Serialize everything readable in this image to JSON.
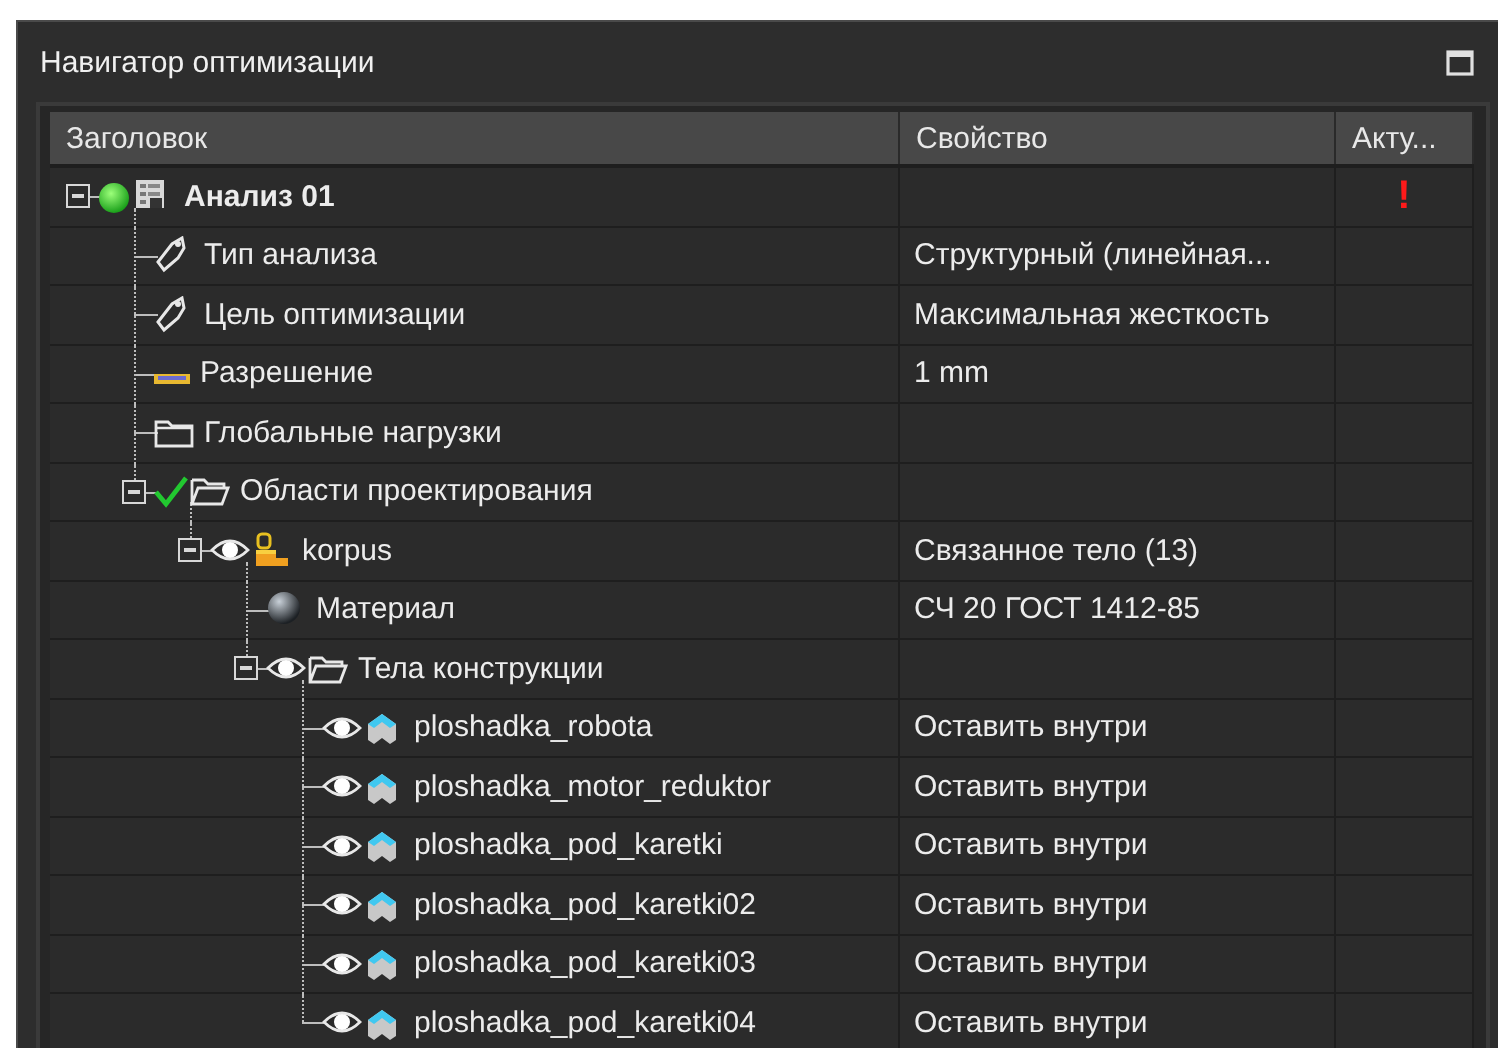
{
  "panel": {
    "title": "Навигатор оптимизации"
  },
  "table": {
    "columns": [
      "Заголовок",
      "Свойство",
      "Акту..."
    ],
    "tree": [
      {
        "kind": "analysis",
        "title": "Анализ 01",
        "bold": true,
        "visible": false,
        "expanded": true,
        "actuality": "!",
        "children": [
          {
            "kind": "tag",
            "title": "Тип анализа",
            "visible": false,
            "property": "Структурный (линейная..."
          },
          {
            "kind": "tag",
            "title": "Цель оптимизации",
            "visible": false,
            "property": "Максимальная жесткость"
          },
          {
            "kind": "ruler",
            "title": "Разрешение",
            "visible": false,
            "property": "1 mm"
          },
          {
            "kind": "folder",
            "title": "Глобальные нагрузки",
            "visible": false
          },
          {
            "kind": "design-region",
            "title": "Области проектирования",
            "visible": false,
            "expanded": true,
            "children": [
              {
                "kind": "part",
                "title": "korpus",
                "visible": true,
                "expanded": true,
                "property": "Связанное тело (13)",
                "children": [
                  {
                    "kind": "material",
                    "title": "Материал",
                    "visible": false,
                    "property": "СЧ 20 ГОСТ 1412-85"
                  },
                  {
                    "kind": "folder-open",
                    "title": "Тела конструкции",
                    "visible": true,
                    "expanded": true,
                    "children": [
                      {
                        "kind": "body",
                        "title": "ploshadka_robota",
                        "visible": true,
                        "property": "Оставить внутри"
                      },
                      {
                        "kind": "body",
                        "title": "ploshadka_motor_reduktor",
                        "visible": true,
                        "property": "Оставить внутри"
                      },
                      {
                        "kind": "body",
                        "title": "ploshadka_pod_karetki",
                        "visible": true,
                        "property": "Оставить внутри"
                      },
                      {
                        "kind": "body",
                        "title": "ploshadka_pod_karetki02",
                        "visible": true,
                        "property": "Оставить внутри"
                      },
                      {
                        "kind": "body",
                        "title": "ploshadka_pod_karetki03",
                        "visible": true,
                        "property": "Оставить внутри"
                      },
                      {
                        "kind": "body",
                        "title": "ploshadka_pod_karetki04",
                        "visible": true,
                        "property": "Оставить внутри"
                      }
                    ]
                  }
                ]
              }
            ]
          }
        ]
      }
    ]
  }
}
